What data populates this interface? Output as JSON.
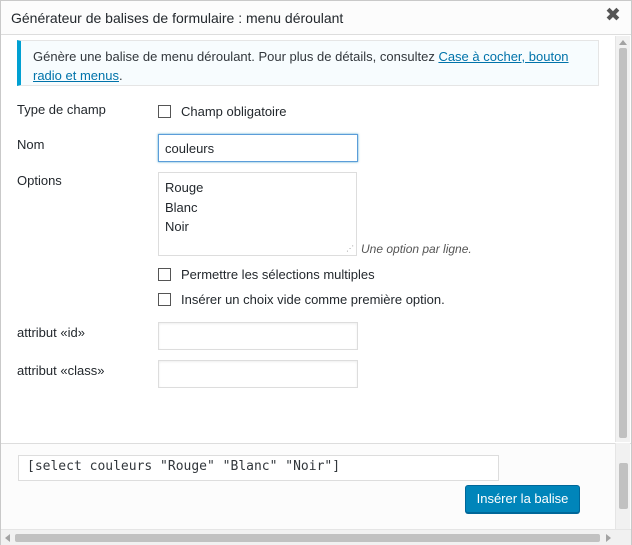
{
  "dialog": {
    "title": "Générateur de balises de formulaire : menu déroulant",
    "close_icon": "close-icon",
    "close_glyph": "✖"
  },
  "notice": {
    "text": "Génère une balise de menu déroulant. Pour plus de détails, consultez ",
    "link_text": "Case à cocher, bouton radio et menus",
    "suffix": "."
  },
  "form": {
    "field_type": {
      "label": "Type de champ",
      "required_label": "Champ obligatoire",
      "required_checked": false
    },
    "name": {
      "label": "Nom",
      "value": "couleurs"
    },
    "options": {
      "label": "Options",
      "values": [
        "Rouge",
        "Blanc",
        "Noir"
      ],
      "hint": "Une option par ligne.",
      "multiple_label": "Permettre les sélections multiples",
      "multiple_checked": false,
      "blank_first_label": "Insérer un choix vide comme première option.",
      "blank_first_checked": false
    },
    "id_attr": {
      "label": "attribut «id»",
      "value": ""
    },
    "class_attr": {
      "label": "attribut «class»",
      "value": ""
    }
  },
  "footer": {
    "tag_output": "[select couleurs \"Rouge\" \"Blanc\" \"Noir\"]",
    "insert_button": "Insérer la balise"
  },
  "colors": {
    "accent": "#0085ba",
    "link": "#0073aa",
    "notice_border": "#00a0d2"
  }
}
